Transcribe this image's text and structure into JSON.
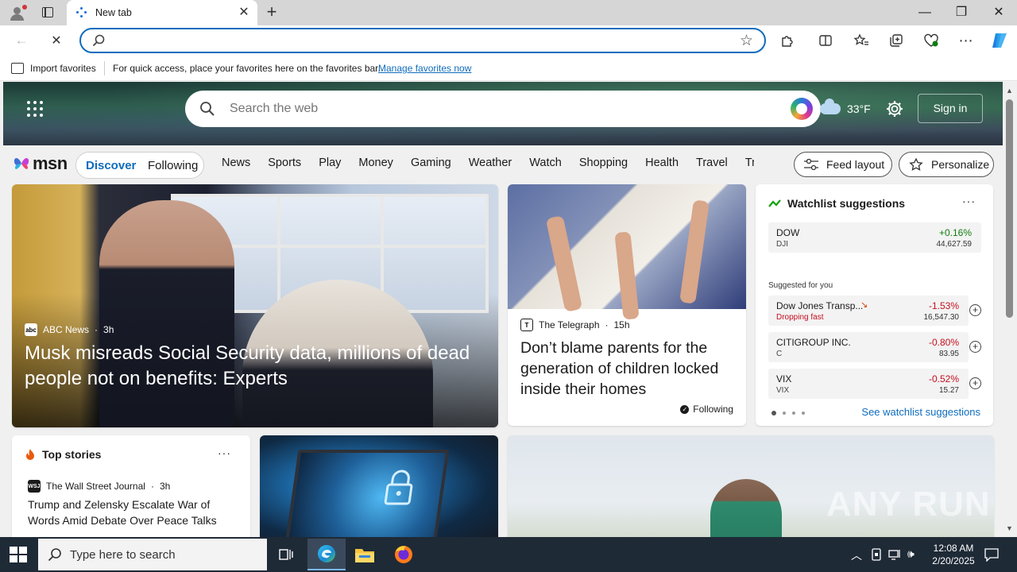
{
  "browser": {
    "tab_title": "New tab",
    "address_value": "",
    "controls": {
      "minimize": "—",
      "restore": "❐",
      "close": "✕"
    }
  },
  "favorites_bar": {
    "import_label": "Import favorites",
    "message": "For quick access, place your favorites here on the favorites bar.",
    "manage_link": "Manage favorites now"
  },
  "msn": {
    "search_placeholder": "Search the web",
    "weather_temp": "33°F",
    "sign_in": "Sign in",
    "logo_text": "msn",
    "feed_tabs": [
      "Discover",
      "Following"
    ],
    "categories": [
      "News",
      "Sports",
      "Play",
      "Money",
      "Gaming",
      "Weather",
      "Watch",
      "Shopping",
      "Health",
      "Travel",
      "Tra"
    ],
    "feed_layout": "Feed layout",
    "personalize": "Personalize"
  },
  "hero_story": {
    "source": "ABC News",
    "age": "3h",
    "headline": "Musk misreads Social Security data, millions of dead people not on benefits: Experts"
  },
  "telegraph_story": {
    "source": "The Telegraph",
    "age": "15h",
    "headline": "Don’t blame parents for the generation of children locked inside their homes",
    "following": "Following"
  },
  "watchlist": {
    "title": "Watchlist suggestions",
    "top": {
      "name": "DOW",
      "ticker": "DJI",
      "change": "+0.16%",
      "price": "44,627.59",
      "color": "#107c10"
    },
    "suggested_label": "Suggested for you",
    "items": [
      {
        "name": "Dow Jones Transp...",
        "ticker": "Dropping fast",
        "change": "-1.53%",
        "price": "16,547.30",
        "color": "#c50f1f"
      },
      {
        "name": "CITIGROUP INC.",
        "ticker": "C",
        "change": "-0.80%",
        "price": "83.95",
        "color": "#c50f1f"
      },
      {
        "name": "VIX",
        "ticker": "VIX",
        "change": "-0.52%",
        "price": "15.27",
        "color": "#c50f1f"
      }
    ],
    "see_link": "See watchlist suggestions"
  },
  "top_stories": {
    "title": "Top stories",
    "source": "The Wall Street Journal",
    "age": "3h",
    "headline": "Trump and Zelensky Escalate War of Words Amid Debate Over Peace Talks"
  },
  "watermark": "ANY RUN",
  "taskbar": {
    "search_placeholder": "Type here to search",
    "time": "12:08 AM",
    "date": "2/20/2025"
  }
}
